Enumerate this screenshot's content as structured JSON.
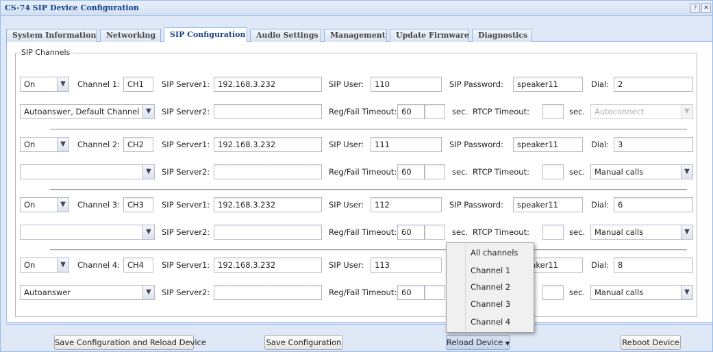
{
  "window": {
    "title": "CS-74 SIP Device Configuration",
    "help_label": "?",
    "close_label": "✕"
  },
  "tabs": [
    {
      "label": "System Information",
      "active": false
    },
    {
      "label": "Networking",
      "active": false
    },
    {
      "label": "SIP Configuration",
      "active": true
    },
    {
      "label": "Audio Settings",
      "active": false
    },
    {
      "label": "Management",
      "active": false
    },
    {
      "label": "Update Firmware",
      "active": false
    },
    {
      "label": "Diagnostics",
      "active": false
    }
  ],
  "labels": {
    "fieldset_legend": "SIP Channels",
    "sip_server1": "SIP Server1:",
    "sip_server2": "SIP Server2:",
    "sip_user": "SIP User:",
    "sip_password": "SIP Password:",
    "dial": "Dial:",
    "reg_fail_timeout": "Reg/Fail Timeout:",
    "sec": "sec.",
    "rtcp_timeout": "RTCP Timeout:"
  },
  "channels": [
    {
      "label": "Channel 1:",
      "state": "On",
      "name": "CH1",
      "server1": "192.168.3.232",
      "user": "110",
      "password": "speaker11",
      "dial": "2",
      "mode": "Autoanswer, Default Channel",
      "server2": "",
      "reg_timeout": "60",
      "reg_timeout_extra": "",
      "rtcp_timeout": "",
      "call_mode": "Autoconnect",
      "call_mode_disabled": true
    },
    {
      "label": "Channel 2:",
      "state": "On",
      "name": "CH2",
      "server1": "192.168.3.232",
      "user": "111",
      "password": "speaker11",
      "dial": "3",
      "mode": "",
      "server2": "",
      "reg_timeout": "60",
      "reg_timeout_extra": "",
      "rtcp_timeout": "",
      "call_mode": "Manual calls",
      "call_mode_disabled": false
    },
    {
      "label": "Channel 3:",
      "state": "On",
      "name": "CH3",
      "server1": "192.168.3.232",
      "user": "112",
      "password": "speaker11",
      "dial": "6",
      "mode": "",
      "server2": "",
      "reg_timeout": "60",
      "reg_timeout_extra": "",
      "rtcp_timeout": "",
      "call_mode": "Manual calls",
      "call_mode_disabled": false
    },
    {
      "label": "Channel 4:",
      "state": "On",
      "name": "CH4",
      "server1": "192.168.3.232",
      "user": "113",
      "password": "speaker11",
      "dial": "8",
      "mode": "Autoanswer",
      "server2": "",
      "reg_timeout": "60",
      "reg_timeout_extra": "",
      "rtcp_timeout": "",
      "call_mode": "Manual calls",
      "call_mode_disabled": false
    }
  ],
  "footer": {
    "save_reload_label": "Save Configuration and Reload Device",
    "save_label": "Save Configuration",
    "reload_label": "Reload Device",
    "reboot_label": "Reboot Device"
  },
  "reload_menu": {
    "items": [
      "All channels",
      "Channel 1",
      "Channel 2",
      "Channel 3",
      "Channel 4"
    ]
  },
  "colors": {
    "accent": "#15428b",
    "panel_border": "#99bbe8",
    "frame_bg": "#dfe8f6"
  }
}
